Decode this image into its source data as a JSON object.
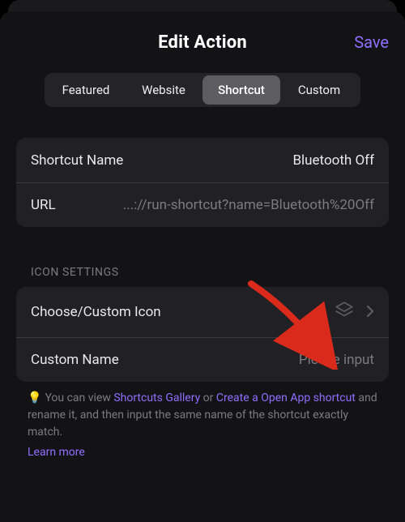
{
  "header": {
    "title": "Edit Action",
    "save_label": "Save"
  },
  "tabs": {
    "items": [
      {
        "label": "Featured",
        "selected": false
      },
      {
        "label": "Website",
        "selected": false
      },
      {
        "label": "Shortcut",
        "selected": true
      },
      {
        "label": "Custom",
        "selected": false
      }
    ]
  },
  "shortcut_card": {
    "name_label": "Shortcut Name",
    "name_value": "Bluetooth Off",
    "url_label": "URL",
    "url_value": "...://run-shortcut?name=Bluetooth%20Off"
  },
  "icon_section": {
    "header": "ICON SETTINGS",
    "choose_label": "Choose/Custom Icon",
    "choose_icon": "layers-icon",
    "custom_name_label": "Custom Name",
    "custom_name_placeholder": "Please input"
  },
  "hint": {
    "bulb": "💡",
    "pre": "You can view ",
    "link1": "Shortcuts Gallery",
    "mid1": " or ",
    "link2": "Create a Open App shortcut",
    "post": " and rename it, and then input the same name of the shortcut exactly match.",
    "learn_more": "Learn more"
  },
  "colors": {
    "accent": "#8f6fff",
    "arrow": "#d92a1c"
  }
}
